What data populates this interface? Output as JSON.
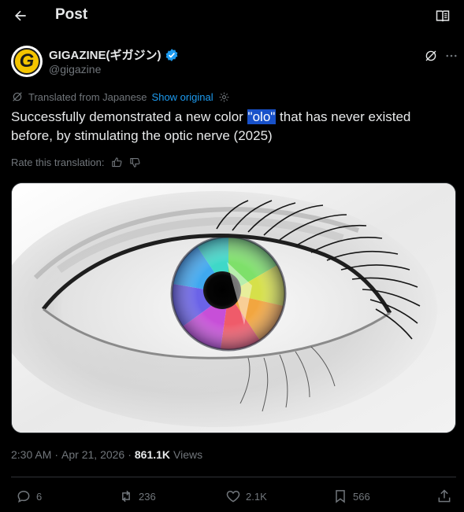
{
  "header": {
    "title": "Post"
  },
  "author": {
    "display_name": "GIGAZINE(ギガジン)",
    "handle": "@gigazine",
    "verified": true,
    "avatar_letter": "G",
    "avatar_color": "#f4c400"
  },
  "translation": {
    "notice": "Translated from Japanese",
    "show_original_label": "Show original"
  },
  "tweet": {
    "text_before": "Successfully demonstrated a new color ",
    "text_highlight": "\"olo\"",
    "text_after": " that has never existed before, by stimulating the optic nerve (2025)"
  },
  "rate": {
    "label": "Rate this translation:"
  },
  "meta": {
    "time": "2:30 AM",
    "separator_1": "·",
    "date": "Apr 21, 2026",
    "separator_2": "·",
    "views_count": "861.1K",
    "views_label": "Views"
  },
  "actions": {
    "replies": "6",
    "reposts": "236",
    "likes": "2.1K",
    "bookmarks": "566"
  },
  "colors": {
    "accent": "#1d9bf0",
    "verified": "#1d9bf0",
    "highlight": "#1851c9",
    "muted": "#71767b"
  },
  "icons": {
    "back": "arrow-left-icon",
    "reader": "reader-mode-icon",
    "grok": "grok-icon",
    "more": "more-horizontal-icon",
    "translate": "translate-icon",
    "settings": "gear-icon",
    "thumbs_up": "thumbs-up-icon",
    "thumbs_down": "thumbs-down-icon",
    "reply": "reply-icon",
    "repost": "repost-icon",
    "like": "heart-icon",
    "bookmark": "bookmark-icon",
    "share": "share-icon"
  }
}
